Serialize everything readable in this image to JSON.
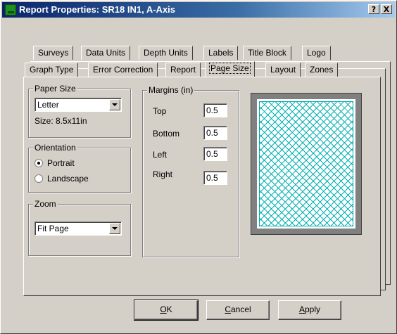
{
  "window": {
    "title": "Report Properties: SR18 IN1, A-Axis",
    "help_label": "?",
    "close_label": "X"
  },
  "tabs_row1": [
    "Surveys",
    "Data Units",
    "Depth Units",
    "Labels",
    "Title Block",
    "Logo"
  ],
  "tabs_row2": [
    "Graph Type",
    "Error Correction",
    "Report",
    "Page Size",
    "Layout",
    "Zones"
  ],
  "active_tab": "Page Size",
  "paper_size": {
    "group_label": "Paper Size",
    "selected": "Letter",
    "size_text": "Size: 8.5x11in"
  },
  "orientation": {
    "group_label": "Orientation",
    "options": [
      "Portrait",
      "Landscape"
    ],
    "selected": "Portrait"
  },
  "zoom": {
    "group_label": "Zoom",
    "selected": "Fit Page"
  },
  "margins": {
    "group_label": "Margins (in)",
    "items": [
      {
        "label": "Top",
        "value": "0.5"
      },
      {
        "label": "Bottom",
        "value": "0.5"
      },
      {
        "label": "Left",
        "value": "0.5"
      },
      {
        "label": "Right",
        "value": "0.5"
      }
    ]
  },
  "buttons": {
    "ok": {
      "mnemonic": "O",
      "rest": "K"
    },
    "cancel": {
      "mnemonic": "C",
      "rest": "ancel"
    },
    "apply": {
      "mnemonic": "A",
      "rest": "pply"
    }
  },
  "colors": {
    "titlebar": "#0a246a",
    "preview_hatch": "#00b0b0",
    "dialog_face": "#d4d0c8"
  }
}
